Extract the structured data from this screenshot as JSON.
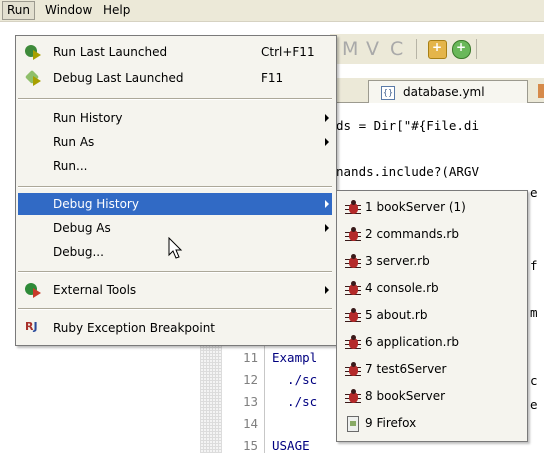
{
  "menubar": {
    "items": [
      {
        "label": "Run",
        "active": true
      },
      {
        "label": "Window",
        "active": false
      },
      {
        "label": "Help",
        "active": false
      }
    ]
  },
  "toolbar": {
    "glyphs": [
      "M",
      "V",
      "C"
    ]
  },
  "editor": {
    "tab_label": "database.yml",
    "tab_icon_glyph": "{}",
    "code_right": [
      {
        "text": "ds = Dir[\"#{File.di"
      },
      {
        "text": "nands.include?(ARGV"
      },
      {
        "text": "e"
      },
      {
        "text": "f"
      },
      {
        "text": "m"
      },
      {
        "text": "c"
      },
      {
        "text": "e"
      }
    ],
    "lines": [
      {
        "num": "11",
        "code": "Exampl"
      },
      {
        "num": "12",
        "code": "  ./sc"
      },
      {
        "num": "13",
        "code": "  ./sc"
      },
      {
        "num": "14",
        "code": ""
      },
      {
        "num": "15",
        "code": "USAGE"
      }
    ]
  },
  "run_menu": {
    "items": [
      {
        "label": "Run Last Launched",
        "accel": "Ctrl+F11",
        "icon": "run-icon"
      },
      {
        "label": "Debug Last Launched",
        "accel": "F11",
        "icon": "debug-icon"
      },
      {
        "label": "Run History",
        "submenu": true
      },
      {
        "label": "Run As",
        "submenu": true
      },
      {
        "label": "Run...",
        "submenu": false
      },
      {
        "label": "Debug History",
        "submenu": true,
        "highlighted": true
      },
      {
        "label": "Debug As",
        "submenu": true
      },
      {
        "label": "Debug...",
        "submenu": false
      },
      {
        "label": "External Tools",
        "submenu": true,
        "icon": "external-tools-icon"
      },
      {
        "label": "Ruby Exception Breakpoint",
        "icon": "ruby-breakpoint-icon"
      }
    ]
  },
  "debug_history": {
    "items": [
      {
        "label": "1 bookServer (1)",
        "icon": "bug-icon"
      },
      {
        "label": "2 commands.rb",
        "icon": "bug-icon"
      },
      {
        "label": "3 server.rb",
        "icon": "bug-icon"
      },
      {
        "label": "4 console.rb",
        "icon": "bug-icon"
      },
      {
        "label": "5 about.rb",
        "icon": "bug-icon"
      },
      {
        "label": "6 application.rb",
        "icon": "bug-icon"
      },
      {
        "label": "7 test6Server",
        "icon": "bug-icon"
      },
      {
        "label": "8 bookServer",
        "icon": "bug-icon"
      },
      {
        "label": "9 Firefox",
        "icon": "document-icon"
      }
    ]
  },
  "colors": {
    "highlight": "#316ac5",
    "menu_bg": "#f5f4ee",
    "bar_bg": "#ece9d8"
  }
}
